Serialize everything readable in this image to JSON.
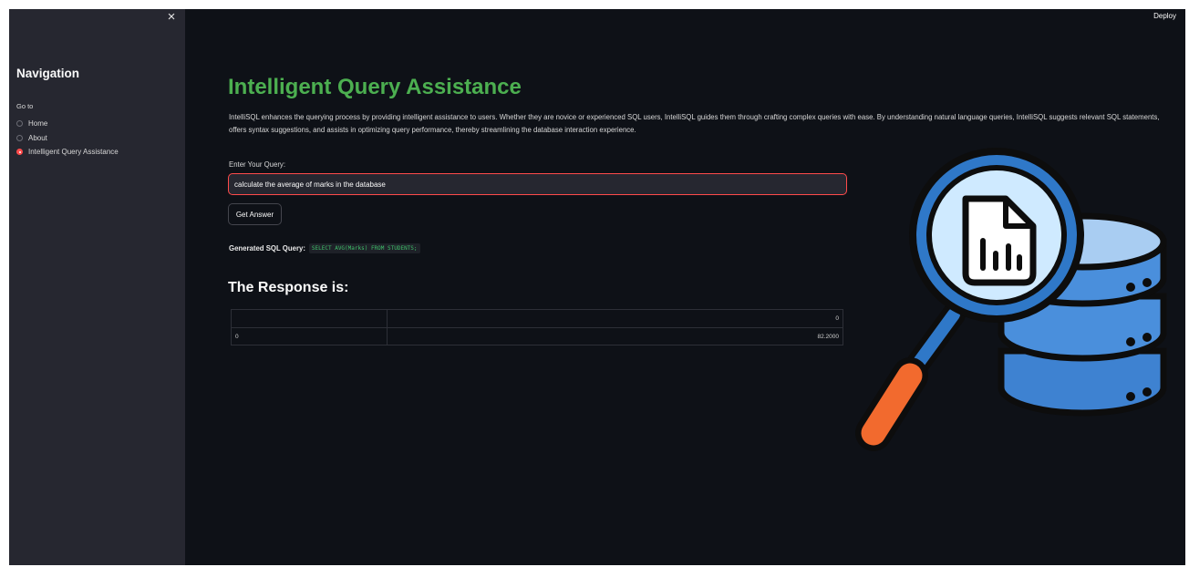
{
  "sidebar": {
    "close_icon": "×",
    "title": "Navigation",
    "goto_label": "Go to",
    "options": [
      {
        "label": "Home",
        "selected": false
      },
      {
        "label": "About",
        "selected": false
      },
      {
        "label": "Intelligent Query Assistance",
        "selected": true
      }
    ]
  },
  "header": {
    "deploy_label": "Deploy"
  },
  "main": {
    "title": "Intelligent Query Assistance",
    "description": "IntelliSQL enhances the querying process by providing intelligent assistance to users. Whether they are novice or experienced SQL users, IntelliSQL guides them through crafting complex queries with ease. By understanding natural language queries, IntelliSQL suggests relevant SQL statements, offers syntax suggestions, and assists in optimizing query performance, thereby streamlining the database interaction experience.",
    "query_label": "Enter Your Query:",
    "query_value": "calculate the average of marks in the database",
    "button_label": "Get Answer",
    "sql_label": "Generated SQL Query:",
    "sql_code": "SELECT AVG(Marks) FROM STUDENTS;",
    "response_title": "The Response is:",
    "table": {
      "header": [
        "",
        "0"
      ],
      "rows": [
        [
          "0",
          "82.2000"
        ]
      ]
    }
  },
  "colors": {
    "accent": "#ff4b4b",
    "title_green": "#4caf50",
    "code_green": "#3fbf6a",
    "background": "#0e1117",
    "sidebar_bg": "#262730"
  },
  "icons": [
    "close-icon",
    "magnifier-document-icon",
    "database-icon"
  ]
}
